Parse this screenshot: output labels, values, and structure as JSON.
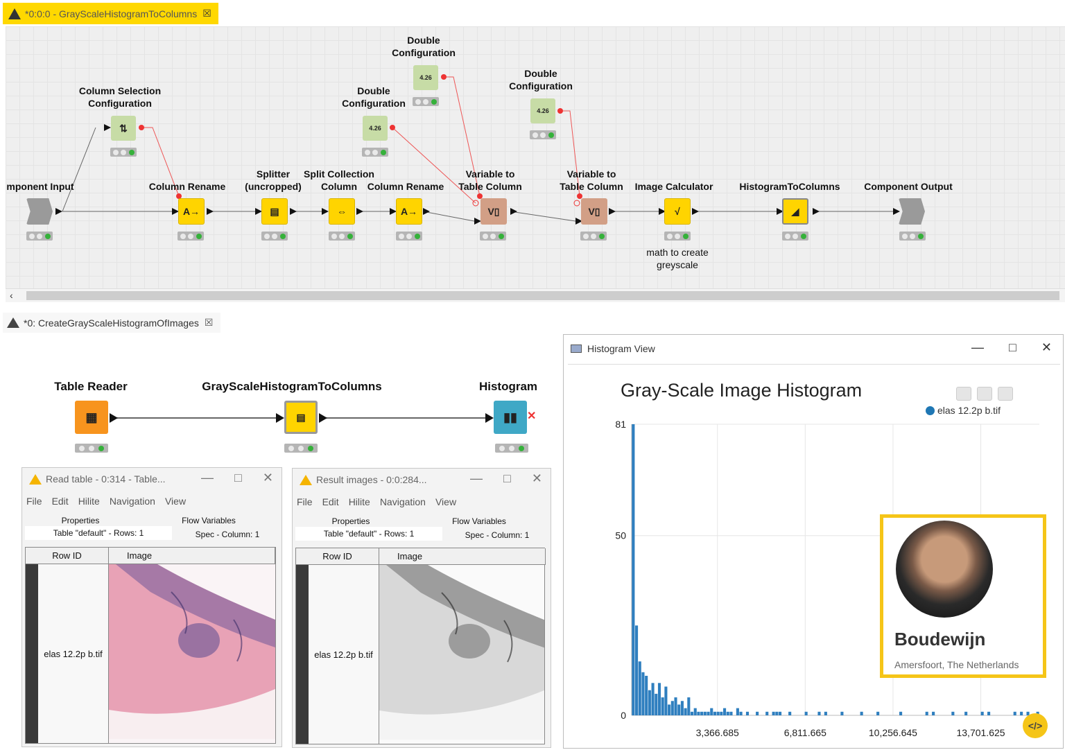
{
  "top_editor": {
    "tab_title": "*0:0:0 - GrayScaleHistogramToColumns",
    "nodes": {
      "component_input": "mponent Input",
      "column_selection": "Column Selection\nConfiguration",
      "column_rename_1": "Column Rename",
      "splitter": "Splitter\n(uncropped)",
      "split_collection": "Split Collection\nColumn",
      "column_rename_2": "Column Rename",
      "double_config_1": "Double\nConfiguration",
      "double_config_2": "Double\nConfiguration",
      "double_config_3": "Double\nConfiguration",
      "var_to_table_1": "Variable to\nTable Column",
      "var_to_table_2": "Variable to\nTable Column",
      "image_calculator": "Image Calculator",
      "image_calculator_note": "math to create\ngreyscale",
      "histogram_to_columns": "HistogramToColumns",
      "component_output": "Component Output"
    },
    "config_value": "4.26"
  },
  "bottom_editor": {
    "tab_title": "*0: CreateGrayScaleHistogramOfImages",
    "nodes": {
      "table_reader": "Table Reader",
      "gray_component": "GrayScaleHistogramToColumns",
      "histogram": "Histogram"
    }
  },
  "read_table_window": {
    "title": "Read table - 0:314 - Table...",
    "menu": [
      "File",
      "Edit",
      "Hilite",
      "Navigation",
      "View"
    ],
    "tab_properties": "Properties",
    "tab_flow_vars": "Flow Variables",
    "tab_table": "Table \"default\" - Rows: 1",
    "tab_spec": "Spec - Column: 1",
    "col_rowid": "Row ID",
    "col_image": "Image",
    "row_label": "elas 12.2p b.tif"
  },
  "result_images_window": {
    "title": "Result images - 0:0:284...",
    "menu": [
      "File",
      "Edit",
      "Hilite",
      "Navigation",
      "View"
    ],
    "tab_properties": "Properties",
    "tab_flow_vars": "Flow Variables",
    "tab_table": "Table \"default\" - Rows: 1",
    "tab_spec": "Spec - Column: 1",
    "col_rowid": "Row ID",
    "col_image": "Image",
    "row_label": "elas 12.2p b.tif"
  },
  "histogram_view": {
    "window_title": "Histogram View",
    "legend_label": "elas 12.2p b.tif",
    "profile_name": "Boudewijn",
    "profile_location": "Amersfoort, The Netherlands",
    "code_button": "</>"
  },
  "chart_data": {
    "type": "bar",
    "title": "Gray-Scale Image Histogram",
    "xlabel": "",
    "ylabel": "",
    "ylim": [
      0,
      81
    ],
    "xlim": [
      0,
      16000
    ],
    "y_ticks": [
      0,
      50,
      81
    ],
    "x_ticks": [
      3366.685,
      6811.665,
      10256.645,
      13701.625
    ],
    "x_tick_labels": [
      "3,366.685",
      "6,811.665",
      "10,256.645",
      "13,701.625"
    ],
    "series": [
      {
        "name": "elas 12.2p b.tif",
        "color": "#2f7fbf",
        "values": [
          81,
          25,
          15,
          12,
          11,
          7,
          9,
          6,
          9,
          5,
          8,
          3,
          4,
          5,
          3,
          4,
          2,
          5,
          1,
          2,
          1,
          1,
          1,
          1,
          2,
          1,
          1,
          1,
          2,
          1,
          1,
          0,
          2,
          1,
          0,
          1,
          0,
          0,
          1,
          0,
          0,
          1,
          0,
          1,
          1,
          1,
          0,
          0,
          1,
          0,
          0,
          0,
          0,
          1,
          0,
          0,
          0,
          1,
          0,
          1,
          0,
          0,
          0,
          0,
          1,
          0,
          0,
          0,
          0,
          0,
          1,
          0,
          0,
          0,
          0,
          1,
          0,
          0,
          0,
          0,
          0,
          0,
          1,
          0,
          0,
          0,
          0,
          0,
          0,
          0,
          1,
          0,
          1,
          0,
          0,
          0,
          0,
          0,
          1,
          0,
          0,
          0,
          1,
          0,
          0,
          0,
          0,
          1,
          0,
          1,
          0,
          0,
          0,
          0,
          0,
          0,
          0,
          1,
          0,
          1,
          0,
          1,
          0,
          0,
          1
        ]
      }
    ],
    "grid": true,
    "legend": "top-right"
  }
}
